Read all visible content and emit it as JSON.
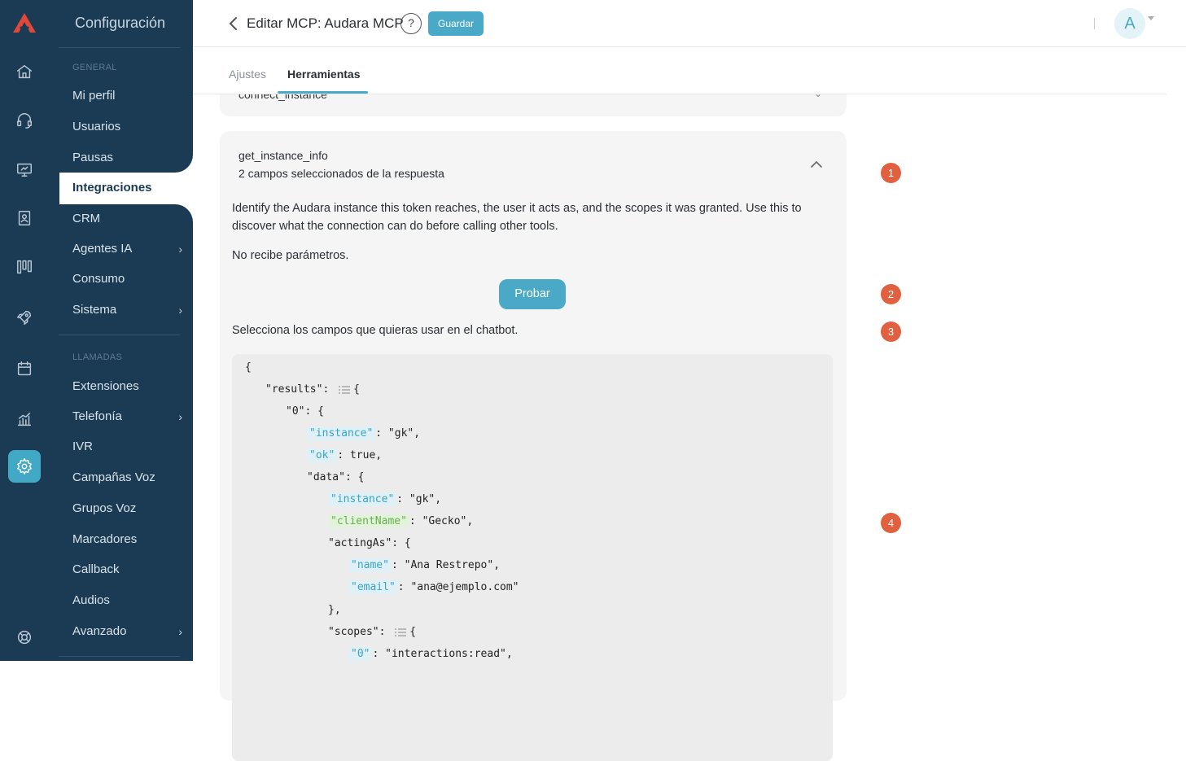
{
  "sidebar": {
    "title": "Configuración",
    "section_general": "GENERAL",
    "section_llamadas": "LLAMADAS",
    "items": [
      {
        "label": "Mi perfil"
      },
      {
        "label": "Usuarios"
      },
      {
        "label": "Pausas"
      },
      {
        "label": "Integraciones"
      },
      {
        "label": "CRM"
      },
      {
        "label": "Agentes IA"
      },
      {
        "label": "Consumo"
      },
      {
        "label": "Sistema"
      },
      {
        "label": "Extensiones"
      },
      {
        "label": "Telefonía"
      },
      {
        "label": "IVR"
      },
      {
        "label": "Campañas Voz"
      },
      {
        "label": "Grupos Voz"
      },
      {
        "label": "Marcadores"
      },
      {
        "label": "Callback"
      },
      {
        "label": "Audios"
      },
      {
        "label": "Avanzado"
      }
    ],
    "chevron": "›"
  },
  "header": {
    "title": "Editar MCP: Audara MCP",
    "help": "?",
    "save_label": "Guardar",
    "avatar_initial": "A"
  },
  "tabs": [
    {
      "label": "Ajustes"
    },
    {
      "label": "Herramientas"
    }
  ],
  "prev_tool": {
    "name": "connect_instance"
  },
  "tool": {
    "name": "get_instance_info",
    "subtitle": "2 campos seleccionados de la respuesta",
    "description": "Identify the Audara instance this token reaches, the user it acts as, and the scopes it was granted. Use this to discover what the connection can do before calling other tools.",
    "no_params": "No recibe parámetros.",
    "test_label": "Probar",
    "select_hint": "Selecciona los campos que quieras usar en el chatbot."
  },
  "json_view": {
    "brace_open": "{",
    "results_key": "\"results\"",
    "idx0_key": "\"0\"",
    "instance_key": "\"instance\"",
    "instance_val": ": \"gk\",",
    "ok_key": "\"ok\"",
    "ok_val": ": true,",
    "data_key": "\"data\": {",
    "data_instance_key": "\"instance\"",
    "data_instance_val": ": \"gk\",",
    "client_key": "\"clientName\"",
    "client_val": ": \"Gecko\",",
    "acting_key": "\"actingAs\": {",
    "name_key": "\"name\"",
    "name_val": ": \"Ana Restrepo\",",
    "email_key": "\"email\"",
    "email_val": ": \"ana@ejemplo.com\"",
    "close_acting": "},",
    "scopes_key": "\"scopes\":",
    "scope0_key": "\"0\"",
    "scope0_val": ": \"interactions:read\","
  },
  "badges": [
    "1",
    "2",
    "3",
    "4"
  ],
  "colors": {
    "sidebar_bg": "#1b3a53",
    "accent": "#4ba9c8",
    "badge": "#e0603f",
    "selected_key": "#3aa3c6",
    "selected_key_alt": "#63b14a"
  }
}
